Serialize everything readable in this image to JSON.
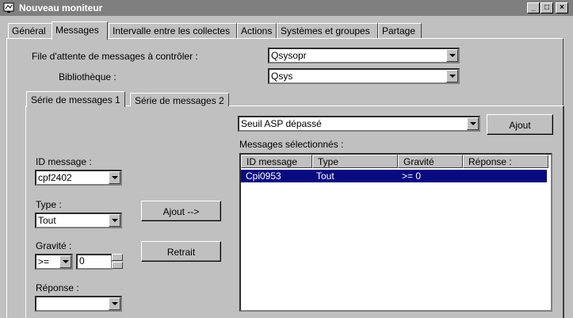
{
  "window": {
    "title": "Nouveau moniteur"
  },
  "tabs": [
    "Général",
    "Messages",
    "Intervalle entre les collectes",
    "Actions",
    "Systèmes et groupes",
    "Partage"
  ],
  "form": {
    "queue_label": "File d'attente de messages à contrôler :",
    "queue_value": "Qsysopr",
    "library_label": "Bibliothèque :",
    "library_value": "Qsys"
  },
  "subtabs": [
    "Série de messages 1",
    "Série de messages 2"
  ],
  "series": {
    "preset_value": "Seuil ASP dépassé",
    "add_button": "Ajout",
    "selected_label": "Messages sélectionnés :",
    "id_label": "ID message :",
    "id_value": "cpf2402",
    "type_label": "Type :",
    "type_value": "Tout",
    "gravity_label": "Gravité :",
    "gravity_op": ">=",
    "gravity_value": "0",
    "response_label": "Réponse :",
    "response_value": "",
    "add_arrow_button": "Ajout -->",
    "remove_button": "Retrait"
  },
  "table": {
    "columns": [
      "ID message",
      "Type",
      "Gravité",
      "Réponse :"
    ],
    "rows": [
      [
        "Cpi0953",
        "Tout",
        ">= 0",
        ""
      ]
    ]
  }
}
